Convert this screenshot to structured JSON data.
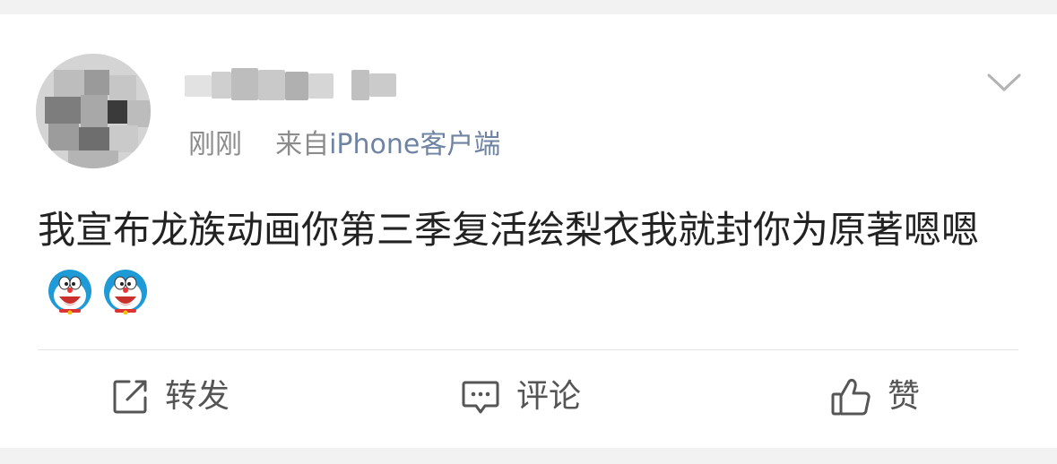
{
  "post": {
    "time": "刚刚",
    "source_prefix": "来自",
    "source_name": "iPhone客户端",
    "text": "我宣布龙族动画你第三季复活绘梨衣我就封你为原著嗯嗯",
    "emojis": [
      "doraemon-emoji",
      "doraemon-emoji"
    ]
  },
  "actions": {
    "repost_label": "转发",
    "comment_label": "评论",
    "like_label": "赞"
  },
  "colors": {
    "page_background": "#f2f2f2",
    "card_background": "#ffffff",
    "meta_gray": "#8c8c8c",
    "source_blue": "#6f84a3",
    "text_dark": "#222222",
    "action_gray": "#555555"
  },
  "icons": {
    "more": "chevron-down-icon",
    "repost": "share-square-icon",
    "comment": "comment-bubble-icon",
    "like": "thumbs-up-icon"
  }
}
